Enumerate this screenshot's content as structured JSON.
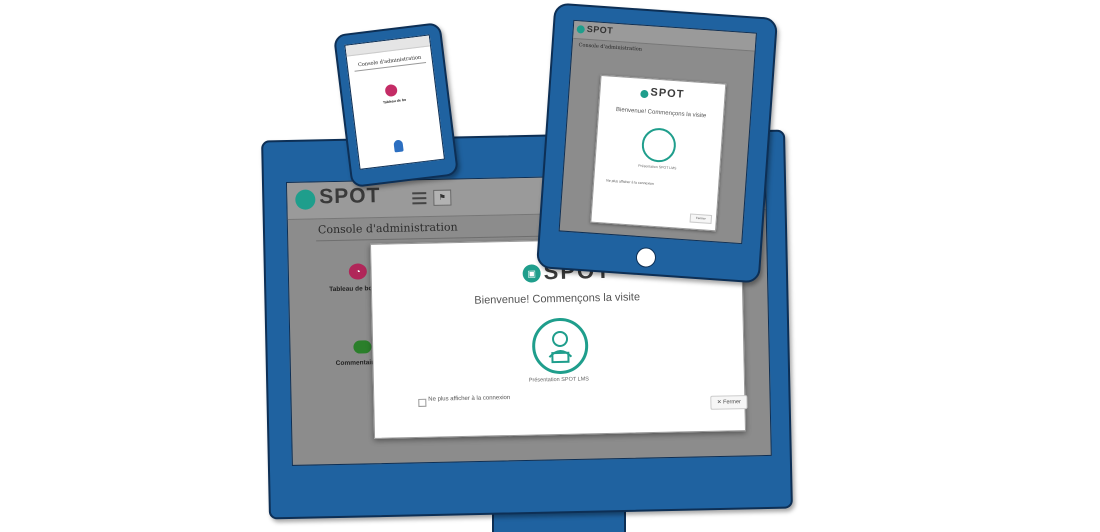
{
  "brand": {
    "name": "SPOT",
    "accent_color": "#1f9e8c",
    "device_frame_color": "#1f62a0"
  },
  "admin": {
    "title": "Console d'administration"
  },
  "tiles": {
    "dashboard": {
      "label": "Tableau de bo"
    },
    "comments": {
      "label": "Commentaires"
    }
  },
  "modal": {
    "title": "Bienvenue! Commençons la visite",
    "illustration_caption": "Présentation SPOT LMS",
    "checkbox_label": "Ne plus afficher à la connexion",
    "close_label": "Fermer"
  }
}
